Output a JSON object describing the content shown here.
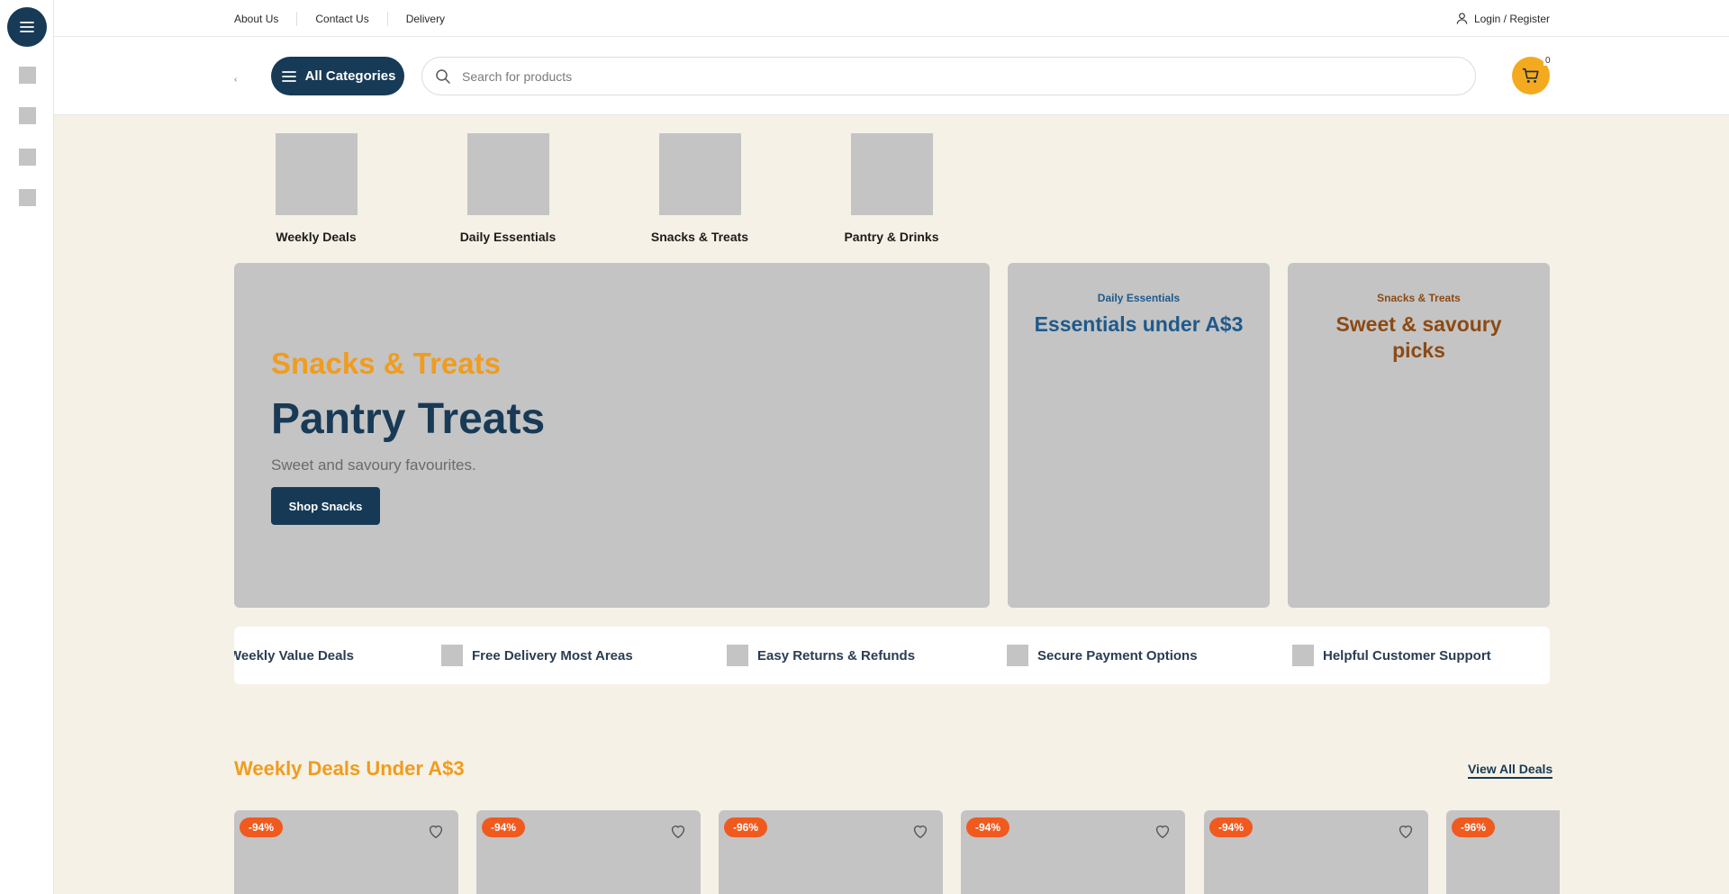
{
  "topbar": {
    "links": [
      "About Us",
      "Contact Us",
      "Delivery"
    ],
    "login_label": "Login / Register"
  },
  "header": {
    "logo_mark": "‹",
    "all_categories_label": "All Categories",
    "search_placeholder": "Search for products",
    "cart_count": "0"
  },
  "categories": [
    {
      "label": "Weekly Deals"
    },
    {
      "label": "Daily Essentials"
    },
    {
      "label": "Snacks & Treats"
    },
    {
      "label": "Pantry & Drinks"
    }
  ],
  "hero": {
    "kicker": "Snacks & Treats",
    "title": "Pantry Treats",
    "subtitle": "Sweet and savoury favourites.",
    "button_label": "Shop Snacks",
    "kicker_color": "#f09c1e",
    "title_color": "#183a56"
  },
  "promos": [
    {
      "kicker": "Daily Essentials",
      "title": "Essentials under A$3",
      "color": "#1e5a8c"
    },
    {
      "kicker": "Snacks & Treats",
      "title": "Sweet & savoury picks",
      "color": "#8c4a14"
    }
  ],
  "features": [
    {
      "label": "Weekly Value Deals",
      "icon": "value-deals-icon"
    },
    {
      "label": "Free Delivery Most Areas",
      "icon": "delivery-icon"
    },
    {
      "label": "Easy Returns & Refunds",
      "icon": "returns-icon"
    },
    {
      "label": "Secure Payment Options",
      "icon": "secure-payment-icon"
    },
    {
      "label": "Helpful Customer Support",
      "icon": "support-icon"
    }
  ],
  "deals": {
    "title": "Weekly Deals Under A$3",
    "view_all_label": "View All Deals",
    "products": [
      {
        "discount": "-94%"
      },
      {
        "discount": "-94%"
      },
      {
        "discount": "-96%"
      },
      {
        "discount": "-94%"
      },
      {
        "discount": "-94%"
      },
      {
        "discount": "-96%"
      }
    ]
  },
  "colors": {
    "brand_navy": "#173a56",
    "accent_orange": "#f09c1e",
    "cart_yellow": "#f3aa1f",
    "badge_red": "#f05a1e",
    "page_background": "#f6f1e6"
  }
}
